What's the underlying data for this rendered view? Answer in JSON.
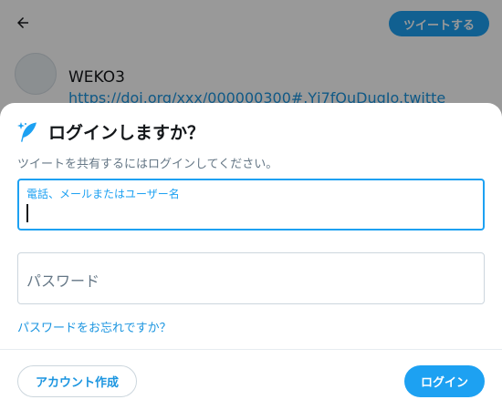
{
  "compose": {
    "tweet_button_label": "ツイートする",
    "account_name": "WEKO3",
    "tweet_link_text": "https://doi.org/xxx/000000300#.Yj7fOuDugIo.twitte"
  },
  "login_sheet": {
    "title": "ログインしますか？",
    "subtitle": "ツイートを共有するにはログインしてください。",
    "username_field": {
      "label": "電話、メールまたはユーザー名",
      "value": ""
    },
    "password_field": {
      "placeholder": "パスワード",
      "value": ""
    },
    "forgot_password_link": "パスワードをお忘れですか？",
    "create_account_button": "アカウント作成",
    "login_button": "ログイン"
  },
  "colors": {
    "accent": "#1da1f2",
    "link": "#1b95e0",
    "overlay": "rgba(0,0,0,0.4)"
  },
  "icons": {
    "back": "arrow-left-icon",
    "title": "feather-icon"
  }
}
